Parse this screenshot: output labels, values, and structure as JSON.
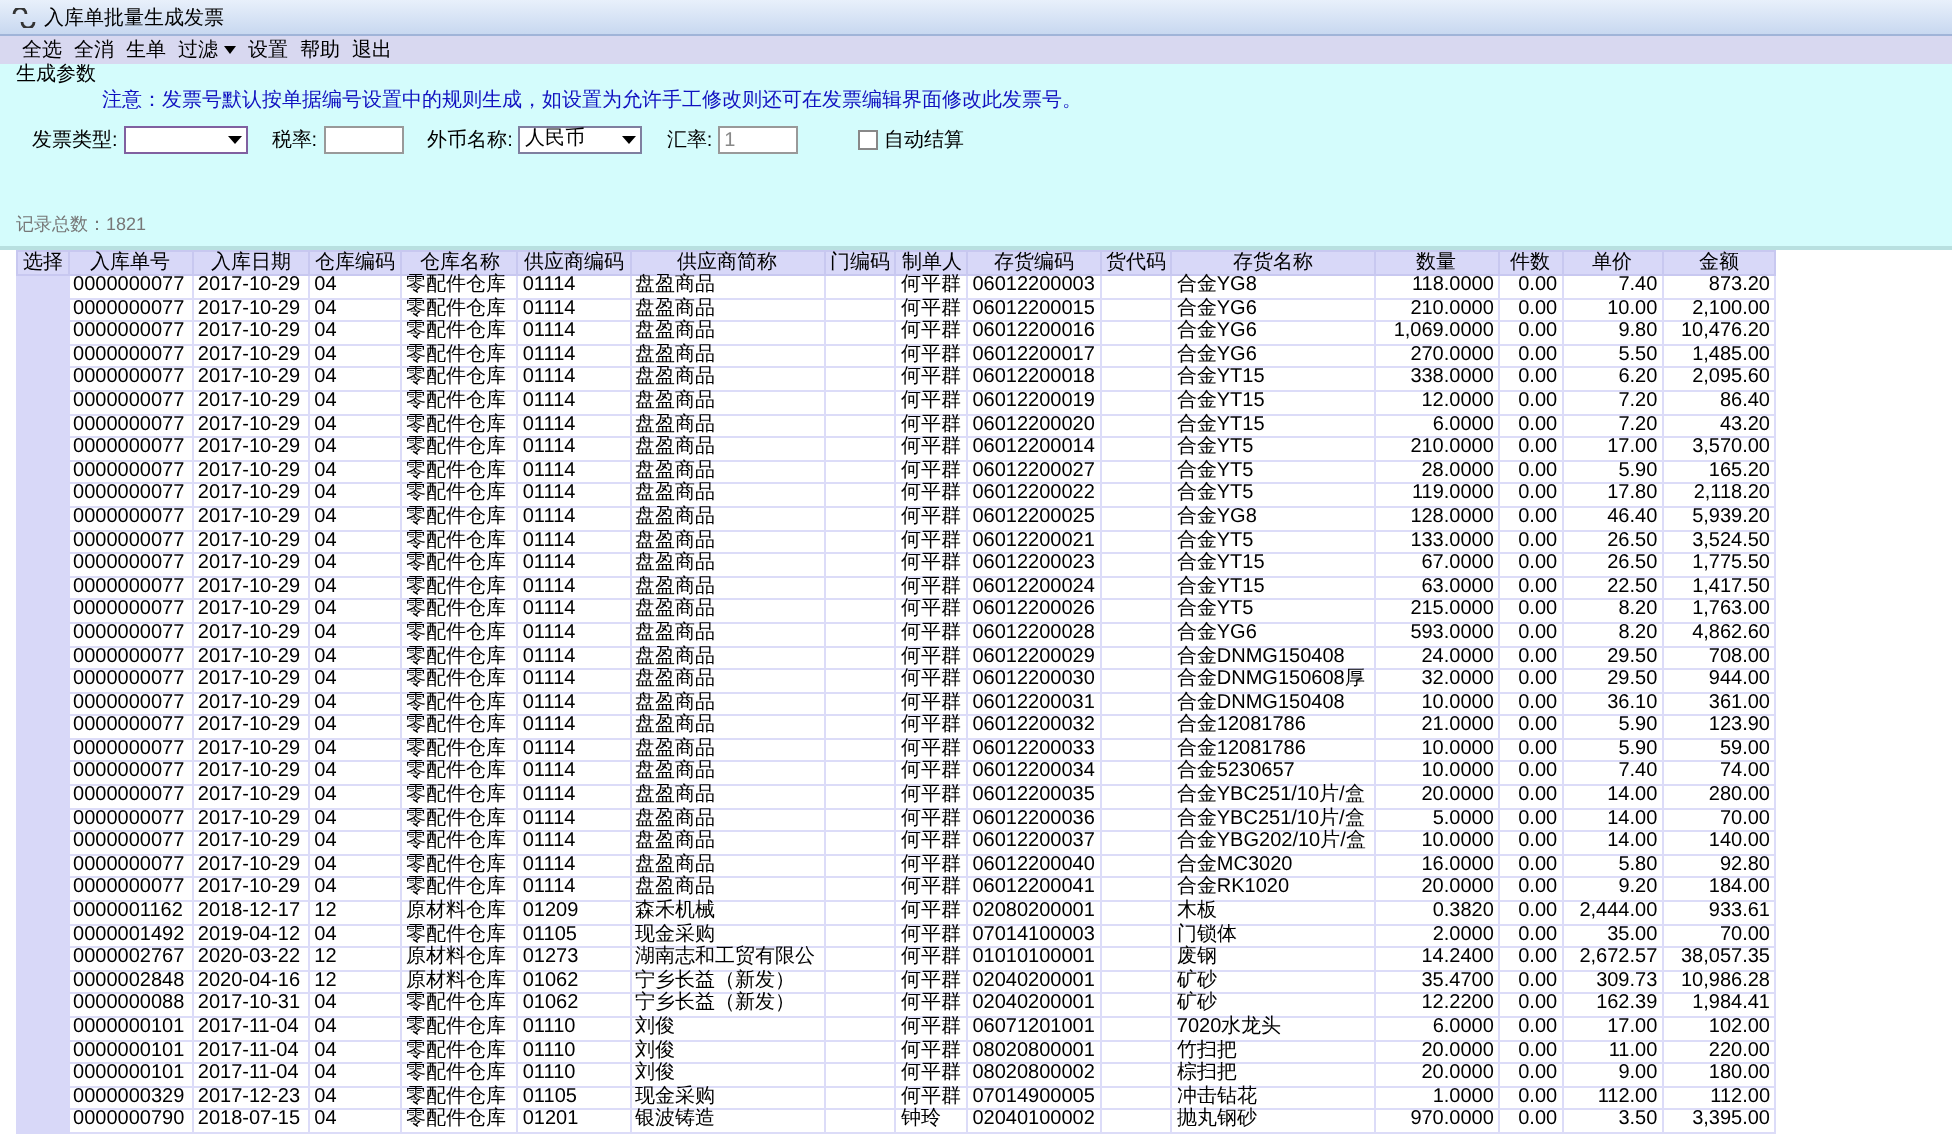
{
  "window": {
    "title": "入库单批量生成发票"
  },
  "menu": [
    {
      "label": "全选"
    },
    {
      "label": "全消"
    },
    {
      "label": "生单"
    },
    {
      "label": "过滤",
      "dropdown": true
    },
    {
      "label": "设置"
    },
    {
      "label": "帮助"
    },
    {
      "label": "退出"
    }
  ],
  "params": {
    "group_label": "生成参数",
    "notice": "注意：发票号默认按单据编号设置中的规则生成，如设置为允许手工修改则还可在发票编辑界面修改此发票号。",
    "fields": [
      {
        "kind": "select",
        "label": "发票类型:"
      },
      {
        "kind": "input",
        "label": "税率:"
      },
      {
        "kind": "select",
        "label": "外币名称:",
        "value": "人民币"
      },
      {
        "kind": "input",
        "label": "汇率:",
        "value": "1"
      },
      {
        "kind": "checkbox",
        "label": "自动结算",
        "checked": false
      }
    ]
  },
  "record_count": "记录总数：1821",
  "table": {
    "columns": [
      "选择",
      "入库单号",
      "入库日期",
      "仓库编码",
      "仓库名称",
      "供应商编码",
      "供应商简称",
      "门编码",
      "制单人",
      "存货编码",
      "货代码",
      "存货名称",
      "数量",
      "件数",
      "单价",
      "金额"
    ],
    "rows": [
      {
        "no": "0000000077",
        "date": "2017-10-29",
        "wh_code": "04",
        "wh_name": "零配件仓库",
        "sup_code": "01114",
        "sup_name": "盘盈商品",
        "maker": "何平群",
        "item_code": "06012200003",
        "item_name": "合金YG8",
        "qty": "118.0000",
        "pieces": "0.00",
        "price": "7.40",
        "amount": "873.20"
      },
      {
        "no": "0000000077",
        "date": "2017-10-29",
        "wh_code": "04",
        "wh_name": "零配件仓库",
        "sup_code": "01114",
        "sup_name": "盘盈商品",
        "maker": "何平群",
        "item_code": "06012200015",
        "item_name": "合金YG6",
        "qty": "210.0000",
        "pieces": "0.00",
        "price": "10.00",
        "amount": "2,100.00"
      },
      {
        "no": "0000000077",
        "date": "2017-10-29",
        "wh_code": "04",
        "wh_name": "零配件仓库",
        "sup_code": "01114",
        "sup_name": "盘盈商品",
        "maker": "何平群",
        "item_code": "06012200016",
        "item_name": "合金YG6",
        "qty": "1,069.0000",
        "pieces": "0.00",
        "price": "9.80",
        "amount": "10,476.20"
      },
      {
        "no": "0000000077",
        "date": "2017-10-29",
        "wh_code": "04",
        "wh_name": "零配件仓库",
        "sup_code": "01114",
        "sup_name": "盘盈商品",
        "maker": "何平群",
        "item_code": "06012200017",
        "item_name": "合金YG6",
        "qty": "270.0000",
        "pieces": "0.00",
        "price": "5.50",
        "amount": "1,485.00"
      },
      {
        "no": "0000000077",
        "date": "2017-10-29",
        "wh_code": "04",
        "wh_name": "零配件仓库",
        "sup_code": "01114",
        "sup_name": "盘盈商品",
        "maker": "何平群",
        "item_code": "06012200018",
        "item_name": "合金YT15",
        "qty": "338.0000",
        "pieces": "0.00",
        "price": "6.20",
        "amount": "2,095.60"
      },
      {
        "no": "0000000077",
        "date": "2017-10-29",
        "wh_code": "04",
        "wh_name": "零配件仓库",
        "sup_code": "01114",
        "sup_name": "盘盈商品",
        "maker": "何平群",
        "item_code": "06012200019",
        "item_name": "合金YT15",
        "qty": "12.0000",
        "pieces": "0.00",
        "price": "7.20",
        "amount": "86.40"
      },
      {
        "no": "0000000077",
        "date": "2017-10-29",
        "wh_code": "04",
        "wh_name": "零配件仓库",
        "sup_code": "01114",
        "sup_name": "盘盈商品",
        "maker": "何平群",
        "item_code": "06012200020",
        "item_name": "合金YT15",
        "qty": "6.0000",
        "pieces": "0.00",
        "price": "7.20",
        "amount": "43.20"
      },
      {
        "no": "0000000077",
        "date": "2017-10-29",
        "wh_code": "04",
        "wh_name": "零配件仓库",
        "sup_code": "01114",
        "sup_name": "盘盈商品",
        "maker": "何平群",
        "item_code": "06012200014",
        "item_name": "合金YT5",
        "qty": "210.0000",
        "pieces": "0.00",
        "price": "17.00",
        "amount": "3,570.00"
      },
      {
        "no": "0000000077",
        "date": "2017-10-29",
        "wh_code": "04",
        "wh_name": "零配件仓库",
        "sup_code": "01114",
        "sup_name": "盘盈商品",
        "maker": "何平群",
        "item_code": "06012200027",
        "item_name": "合金YT5",
        "qty": "28.0000",
        "pieces": "0.00",
        "price": "5.90",
        "amount": "165.20"
      },
      {
        "no": "0000000077",
        "date": "2017-10-29",
        "wh_code": "04",
        "wh_name": "零配件仓库",
        "sup_code": "01114",
        "sup_name": "盘盈商品",
        "maker": "何平群",
        "item_code": "06012200022",
        "item_name": "合金YT5",
        "qty": "119.0000",
        "pieces": "0.00",
        "price": "17.80",
        "amount": "2,118.20"
      },
      {
        "no": "0000000077",
        "date": "2017-10-29",
        "wh_code": "04",
        "wh_name": "零配件仓库",
        "sup_code": "01114",
        "sup_name": "盘盈商品",
        "maker": "何平群",
        "item_code": "06012200025",
        "item_name": "合金YG8",
        "qty": "128.0000",
        "pieces": "0.00",
        "price": "46.40",
        "amount": "5,939.20"
      },
      {
        "no": "0000000077",
        "date": "2017-10-29",
        "wh_code": "04",
        "wh_name": "零配件仓库",
        "sup_code": "01114",
        "sup_name": "盘盈商品",
        "maker": "何平群",
        "item_code": "06012200021",
        "item_name": "合金YT5",
        "qty": "133.0000",
        "pieces": "0.00",
        "price": "26.50",
        "amount": "3,524.50"
      },
      {
        "no": "0000000077",
        "date": "2017-10-29",
        "wh_code": "04",
        "wh_name": "零配件仓库",
        "sup_code": "01114",
        "sup_name": "盘盈商品",
        "maker": "何平群",
        "item_code": "06012200023",
        "item_name": "合金YT15",
        "qty": "67.0000",
        "pieces": "0.00",
        "price": "26.50",
        "amount": "1,775.50"
      },
      {
        "no": "0000000077",
        "date": "2017-10-29",
        "wh_code": "04",
        "wh_name": "零配件仓库",
        "sup_code": "01114",
        "sup_name": "盘盈商品",
        "maker": "何平群",
        "item_code": "06012200024",
        "item_name": "合金YT15",
        "qty": "63.0000",
        "pieces": "0.00",
        "price": "22.50",
        "amount": "1,417.50"
      },
      {
        "no": "0000000077",
        "date": "2017-10-29",
        "wh_code": "04",
        "wh_name": "零配件仓库",
        "sup_code": "01114",
        "sup_name": "盘盈商品",
        "maker": "何平群",
        "item_code": "06012200026",
        "item_name": "合金YT5",
        "qty": "215.0000",
        "pieces": "0.00",
        "price": "8.20",
        "amount": "1,763.00"
      },
      {
        "no": "0000000077",
        "date": "2017-10-29",
        "wh_code": "04",
        "wh_name": "零配件仓库",
        "sup_code": "01114",
        "sup_name": "盘盈商品",
        "maker": "何平群",
        "item_code": "06012200028",
        "item_name": "合金YG6",
        "qty": "593.0000",
        "pieces": "0.00",
        "price": "8.20",
        "amount": "4,862.60"
      },
      {
        "no": "0000000077",
        "date": "2017-10-29",
        "wh_code": "04",
        "wh_name": "零配件仓库",
        "sup_code": "01114",
        "sup_name": "盘盈商品",
        "maker": "何平群",
        "item_code": "06012200029",
        "item_name": "合金DNMG150408",
        "qty": "24.0000",
        "pieces": "0.00",
        "price": "29.50",
        "amount": "708.00"
      },
      {
        "no": "0000000077",
        "date": "2017-10-29",
        "wh_code": "04",
        "wh_name": "零配件仓库",
        "sup_code": "01114",
        "sup_name": "盘盈商品",
        "maker": "何平群",
        "item_code": "06012200030",
        "item_name": "合金DNMG150608厚",
        "qty": "32.0000",
        "pieces": "0.00",
        "price": "29.50",
        "amount": "944.00"
      },
      {
        "no": "0000000077",
        "date": "2017-10-29",
        "wh_code": "04",
        "wh_name": "零配件仓库",
        "sup_code": "01114",
        "sup_name": "盘盈商品",
        "maker": "何平群",
        "item_code": "06012200031",
        "item_name": "合金DNMG150408",
        "qty": "10.0000",
        "pieces": "0.00",
        "price": "36.10",
        "amount": "361.00"
      },
      {
        "no": "0000000077",
        "date": "2017-10-29",
        "wh_code": "04",
        "wh_name": "零配件仓库",
        "sup_code": "01114",
        "sup_name": "盘盈商品",
        "maker": "何平群",
        "item_code": "06012200032",
        "item_name": "合金12081786",
        "qty": "21.0000",
        "pieces": "0.00",
        "price": "5.90",
        "amount": "123.90"
      },
      {
        "no": "0000000077",
        "date": "2017-10-29",
        "wh_code": "04",
        "wh_name": "零配件仓库",
        "sup_code": "01114",
        "sup_name": "盘盈商品",
        "maker": "何平群",
        "item_code": "06012200033",
        "item_name": "合金12081786",
        "qty": "10.0000",
        "pieces": "0.00",
        "price": "5.90",
        "amount": "59.00"
      },
      {
        "no": "0000000077",
        "date": "2017-10-29",
        "wh_code": "04",
        "wh_name": "零配件仓库",
        "sup_code": "01114",
        "sup_name": "盘盈商品",
        "maker": "何平群",
        "item_code": "06012200034",
        "item_name": "合金5230657",
        "qty": "10.0000",
        "pieces": "0.00",
        "price": "7.40",
        "amount": "74.00"
      },
      {
        "no": "0000000077",
        "date": "2017-10-29",
        "wh_code": "04",
        "wh_name": "零配件仓库",
        "sup_code": "01114",
        "sup_name": "盘盈商品",
        "maker": "何平群",
        "item_code": "06012200035",
        "item_name": "合金YBC251/10片/盒",
        "qty": "20.0000",
        "pieces": "0.00",
        "price": "14.00",
        "amount": "280.00"
      },
      {
        "no": "0000000077",
        "date": "2017-10-29",
        "wh_code": "04",
        "wh_name": "零配件仓库",
        "sup_code": "01114",
        "sup_name": "盘盈商品",
        "maker": "何平群",
        "item_code": "06012200036",
        "item_name": "合金YBC251/10片/盒",
        "qty": "5.0000",
        "pieces": "0.00",
        "price": "14.00",
        "amount": "70.00"
      },
      {
        "no": "0000000077",
        "date": "2017-10-29",
        "wh_code": "04",
        "wh_name": "零配件仓库",
        "sup_code": "01114",
        "sup_name": "盘盈商品",
        "maker": "何平群",
        "item_code": "06012200037",
        "item_name": "合金YBG202/10片/盒",
        "qty": "10.0000",
        "pieces": "0.00",
        "price": "14.00",
        "amount": "140.00"
      },
      {
        "no": "0000000077",
        "date": "2017-10-29",
        "wh_code": "04",
        "wh_name": "零配件仓库",
        "sup_code": "01114",
        "sup_name": "盘盈商品",
        "maker": "何平群",
        "item_code": "06012200040",
        "item_name": "合金MC3020",
        "qty": "16.0000",
        "pieces": "0.00",
        "price": "5.80",
        "amount": "92.80"
      },
      {
        "no": "0000000077",
        "date": "2017-10-29",
        "wh_code": "04",
        "wh_name": "零配件仓库",
        "sup_code": "01114",
        "sup_name": "盘盈商品",
        "maker": "何平群",
        "item_code": "06012200041",
        "item_name": "合金RK1020",
        "qty": "20.0000",
        "pieces": "0.00",
        "price": "9.20",
        "amount": "184.00"
      },
      {
        "no": "0000001162",
        "date": "2018-12-17",
        "wh_code": "12",
        "wh_name": "原材料仓库",
        "sup_code": "01209",
        "sup_name": "森禾机械",
        "maker": "何平群",
        "item_code": "02080200001",
        "item_name": "木板",
        "qty": "0.3820",
        "pieces": "0.00",
        "price": "2,444.00",
        "amount": "933.61"
      },
      {
        "no": "0000001492",
        "date": "2019-04-12",
        "wh_code": "04",
        "wh_name": "零配件仓库",
        "sup_code": "01105",
        "sup_name": "现金采购",
        "maker": "何平群",
        "item_code": "07014100003",
        "item_name": "门锁体",
        "qty": "2.0000",
        "pieces": "0.00",
        "price": "35.00",
        "amount": "70.00"
      },
      {
        "no": "0000002767",
        "date": "2020-03-22",
        "wh_code": "12",
        "wh_name": "原材料仓库",
        "sup_code": "01273",
        "sup_name": "湖南志和工贸有限公",
        "maker": "何平群",
        "item_code": "01010100001",
        "item_name": "废钢",
        "qty": "14.2400",
        "pieces": "0.00",
        "price": "2,672.57",
        "amount": "38,057.35"
      },
      {
        "no": "0000002848",
        "date": "2020-04-16",
        "wh_code": "12",
        "wh_name": "原材料仓库",
        "sup_code": "01062",
        "sup_name": "宁乡长益（新发）",
        "maker": "何平群",
        "item_code": "02040200001",
        "item_name": "矿砂",
        "qty": "35.4700",
        "pieces": "0.00",
        "price": "309.73",
        "amount": "10,986.28"
      },
      {
        "no": "0000000088",
        "date": "2017-10-31",
        "wh_code": "04",
        "wh_name": "零配件仓库",
        "sup_code": "01062",
        "sup_name": "宁乡长益（新发）",
        "maker": "何平群",
        "item_code": "02040200001",
        "item_name": "矿砂",
        "qty": "12.2200",
        "pieces": "0.00",
        "price": "162.39",
        "amount": "1,984.41"
      },
      {
        "no": "0000000101",
        "date": "2017-11-04",
        "wh_code": "04",
        "wh_name": "零配件仓库",
        "sup_code": "01110",
        "sup_name": "刘俊",
        "maker": "何平群",
        "item_code": "06071201001",
        "item_name": "7020水龙头",
        "qty": "6.0000",
        "pieces": "0.00",
        "price": "17.00",
        "amount": "102.00"
      },
      {
        "no": "0000000101",
        "date": "2017-11-04",
        "wh_code": "04",
        "wh_name": "零配件仓库",
        "sup_code": "01110",
        "sup_name": "刘俊",
        "maker": "何平群",
        "item_code": "08020800001",
        "item_name": "竹扫把",
        "qty": "20.0000",
        "pieces": "0.00",
        "price": "11.00",
        "amount": "220.00"
      },
      {
        "no": "0000000101",
        "date": "2017-11-04",
        "wh_code": "04",
        "wh_name": "零配件仓库",
        "sup_code": "01110",
        "sup_name": "刘俊",
        "maker": "何平群",
        "item_code": "08020800002",
        "item_name": "棕扫把",
        "qty": "20.0000",
        "pieces": "0.00",
        "price": "9.00",
        "amount": "180.00"
      },
      {
        "no": "0000000329",
        "date": "2017-12-23",
        "wh_code": "04",
        "wh_name": "零配件仓库",
        "sup_code": "01105",
        "sup_name": "现金采购",
        "maker": "何平群",
        "item_code": "07014900005",
        "item_name": "冲击钻花",
        "qty": "1.0000",
        "pieces": "0.00",
        "price": "112.00",
        "amount": "112.00"
      },
      {
        "no": "0000000790",
        "date": "2018-07-15",
        "wh_code": "04",
        "wh_name": "零配件仓库",
        "sup_code": "01201",
        "sup_name": "银波铸造",
        "maker": "钟玲",
        "item_code": "02040100002",
        "item_name": "抛丸钢砂",
        "qty": "970.0000",
        "pieces": "0.00",
        "price": "3.50",
        "amount": "3,395.00"
      }
    ]
  }
}
